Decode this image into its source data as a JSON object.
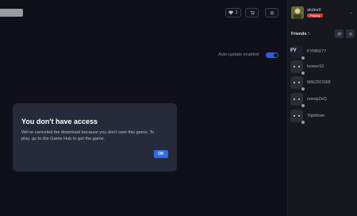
{
  "topbar": {
    "wishlist_count": "1",
    "wishlist_icon": "heart-icon",
    "cart_icon": "cart-icon",
    "notifications_icon": "bell-icon"
  },
  "settings": {
    "auto_update_label": "Auto-update enabled",
    "auto_update_on": true
  },
  "dialog": {
    "title": "You don't have access",
    "body": "We've canceled the download because you don't own this game. To play, go to the Game Hub to get the game.",
    "ok_label": "OK"
  },
  "user": {
    "name": "alufee9",
    "status": "Playing"
  },
  "friends": {
    "heading": "Friends",
    "count": "5",
    "list": [
      {
        "name": "FYNNX77"
      },
      {
        "name": "keeerr10"
      },
      {
        "name": "MACROS68"
      },
      {
        "name": "nosvpZeQ"
      },
      {
        "name": "Yigddose"
      }
    ]
  },
  "colors": {
    "accent": "#2f6ae9",
    "status_red": "#d63b3b",
    "dialog_bg": "#272a3b"
  }
}
